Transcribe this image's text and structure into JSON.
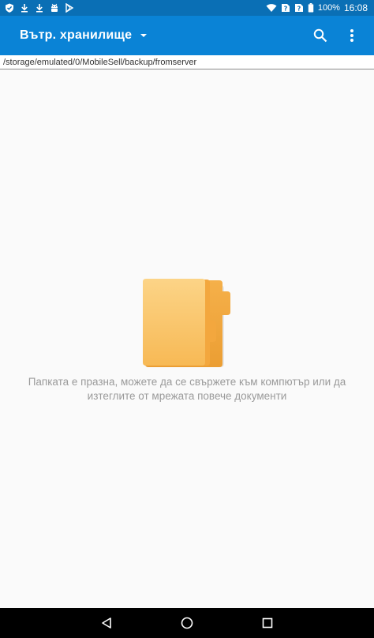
{
  "status_bar": {
    "time": "16:08",
    "battery_percent": "100%",
    "notification_icons": [
      "shield-icon",
      "download-icon",
      "download-icon",
      "android-icon",
      "play-store-icon"
    ],
    "system_icons": [
      "wifi-icon",
      "sim-unknown-icon",
      "sim-unknown-icon",
      "battery-icon"
    ]
  },
  "app_bar": {
    "title": "Вътр. хранилище",
    "actions": [
      "search-icon",
      "more-vert-icon"
    ]
  },
  "path_bar": {
    "path": "/storage/emulated/0/MobileSell/backup/fromserver"
  },
  "empty_state": {
    "message": "Папката е празна, можете да се свържете към компютър или да изтеглите от мрежата повече документи"
  },
  "nav_bar": {
    "buttons": [
      "back-icon",
      "home-icon",
      "recents-icon"
    ]
  },
  "colors": {
    "status_bar": "#0a6fb5",
    "app_bar": "#0a83d6",
    "folder": "#f7b955"
  }
}
